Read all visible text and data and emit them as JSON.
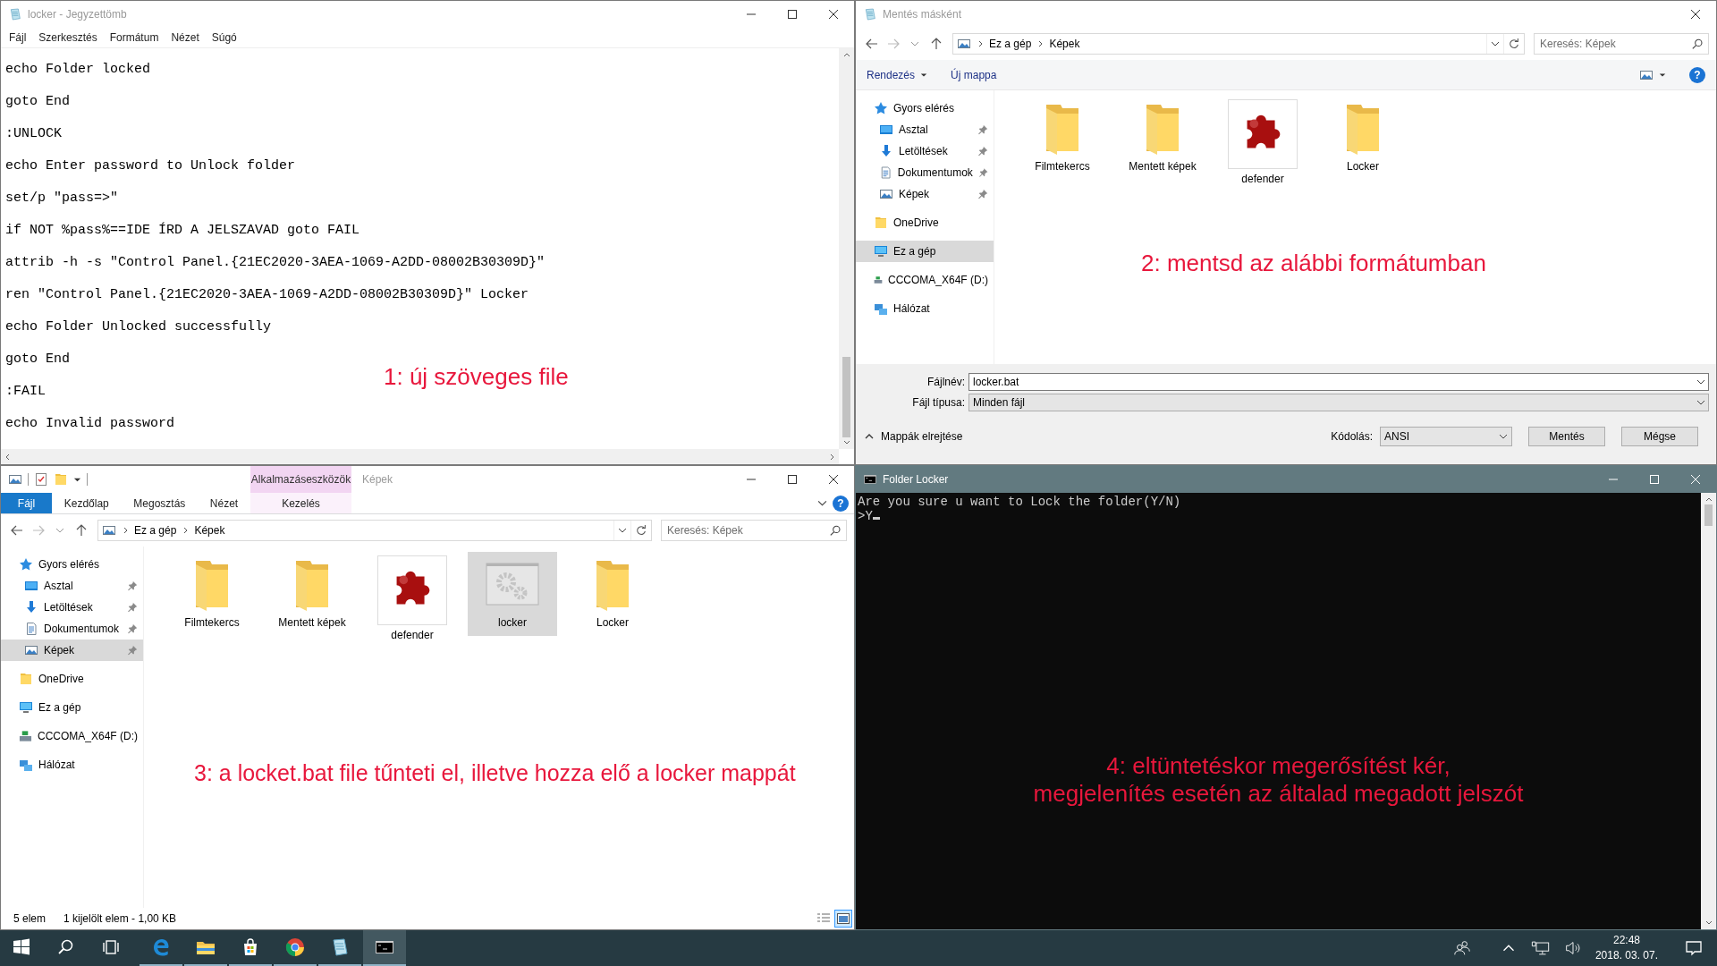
{
  "notepad": {
    "title": "locker - Jegyzettömb",
    "menu": [
      "Fájl",
      "Szerkesztés",
      "Formátum",
      "Nézet",
      "Súgó"
    ],
    "lines": [
      "echo Folder locked",
      "goto End",
      ":UNLOCK",
      "echo Enter password to Unlock folder",
      "set/p \"pass=>\"",
      "if NOT %pass%==IDE ÍRD A JELSZAVAD goto FAIL",
      "attrib -h -s \"Control Panel.{21EC2020-3AEA-1069-A2DD-08002B30309D}\"",
      "ren \"Control Panel.{21EC2020-3AEA-1069-A2DD-08002B30309D}\" Locker",
      "echo Folder Unlocked successfully",
      "goto End",
      ":FAIL",
      "echo Invalid password"
    ],
    "annotation": "1: új szöveges file"
  },
  "save_dialog": {
    "title": "Mentés másként",
    "path": [
      "Ez a gép",
      "Képek"
    ],
    "search": {
      "placeholder": "Keresés: Képek"
    },
    "toolbar": [
      {
        "label": "Rendezés",
        "kind": "menu"
      },
      {
        "label": "Új mappa",
        "kind": "plain"
      }
    ],
    "help": "?",
    "nav": [
      {
        "label": "Gyors elérés",
        "kind": "quick",
        "selected": false,
        "children": [
          {
            "label": "Asztal",
            "kind": "desktop",
            "selected": false
          },
          {
            "label": "Letöltések",
            "kind": "download",
            "selected": false
          },
          {
            "label": "Dokumentumok",
            "kind": "docs",
            "selected": false
          },
          {
            "label": "Képek",
            "kind": "pictures",
            "selected": false
          }
        ]
      },
      {
        "label": "OneDrive",
        "kind": "onedrive",
        "selected": false
      },
      {
        "label": "Ez a gép",
        "kind": "pc",
        "selected": true
      },
      {
        "label": "CCCOMA_X64F (D:)",
        "kind": "drive",
        "selected": false
      },
      {
        "label": "Hálózat",
        "kind": "network",
        "selected": false
      }
    ],
    "files": [
      {
        "name": "Filmtekercs",
        "kind": "folder",
        "selected": false
      },
      {
        "name": "Mentett képek",
        "kind": "folder",
        "selected": false
      },
      {
        "name": "defender",
        "kind": "app",
        "selected": false
      },
      {
        "name": "Locker",
        "kind": "folder",
        "selected": false
      }
    ],
    "annotation": "2: mentsd az alábbi formátumban",
    "fields": [
      {
        "label": "Fájlnév:",
        "value": "locker.bat",
        "kind": "combo"
      },
      {
        "label": "Fájl típusa:",
        "value": "Minden fájl",
        "kind": "select"
      }
    ],
    "hide_folders": "Mappák elrejtése",
    "encoding": {
      "label": "Kódolás:",
      "value": "ANSI"
    },
    "buttons": [
      "Mentés",
      "Mégse"
    ]
  },
  "explorer": {
    "title": "Képek",
    "context_group": "Alkalmazáseszközök",
    "tabs": [
      {
        "label": "Fájl",
        "kind": "file"
      },
      {
        "label": "Kezdőlap",
        "kind": "tab"
      },
      {
        "label": "Megosztás",
        "kind": "tab"
      },
      {
        "label": "Nézet",
        "kind": "tab"
      },
      {
        "label": "Kezelés",
        "kind": "context"
      }
    ],
    "help": "?",
    "path": [
      "Ez a gép",
      "Képek"
    ],
    "search": {
      "placeholder": "Keresés: Képek"
    },
    "nav": [
      {
        "label": "Gyors elérés",
        "kind": "quick",
        "selected": false,
        "children": [
          {
            "label": "Asztal",
            "kind": "desktop",
            "selected": false
          },
          {
            "label": "Letöltések",
            "kind": "download",
            "selected": false
          },
          {
            "label": "Dokumentumok",
            "kind": "docs",
            "selected": false
          },
          {
            "label": "Képek",
            "kind": "pictures",
            "selected": true
          }
        ]
      },
      {
        "label": "OneDrive",
        "kind": "onedrive",
        "selected": false
      },
      {
        "label": "Ez a gép",
        "kind": "pc",
        "selected": false
      },
      {
        "label": "CCCOMA_X64F (D:)",
        "kind": "drive",
        "selected": false
      },
      {
        "label": "Hálózat",
        "kind": "network",
        "selected": false
      }
    ],
    "files": [
      {
        "name": "Filmtekercs",
        "kind": "folder",
        "selected": false
      },
      {
        "name": "Mentett képek",
        "kind": "folder",
        "selected": false
      },
      {
        "name": "defender",
        "kind": "app",
        "selected": false
      },
      {
        "name": "locker",
        "kind": "batch",
        "selected": true
      },
      {
        "name": "Locker",
        "kind": "folder",
        "selected": false
      }
    ],
    "annotation": "3: a locket.bat file tűnteti el, illetve hozza elő a locker mappát",
    "status": [
      "5 elem",
      "1 kijelölt elem - 1,00 KB"
    ],
    "views": [
      {
        "kind": "details",
        "selected": false
      },
      {
        "kind": "large",
        "selected": true
      }
    ]
  },
  "console": {
    "title": "Folder Locker",
    "lines": [
      "Are you sure u want to Lock the folder(Y/N)",
      ">Y"
    ],
    "annotation": [
      "4: eltüntetéskor megerősítést kér,",
      "megjelenítés esetén az általad megadott jelszót"
    ]
  },
  "taskbar": {
    "apps": [
      {
        "kind": "start",
        "running": false,
        "active": false
      },
      {
        "kind": "search",
        "running": false,
        "active": false
      },
      {
        "kind": "taskview",
        "running": false,
        "active": false
      },
      {
        "kind": "edge",
        "running": true,
        "active": false
      },
      {
        "kind": "explorer",
        "running": true,
        "active": false
      },
      {
        "kind": "store",
        "running": true,
        "active": false
      },
      {
        "kind": "chrome",
        "running": true,
        "active": false
      },
      {
        "kind": "notepad",
        "running": true,
        "active": false
      },
      {
        "kind": "cmd",
        "running": true,
        "active": true
      }
    ],
    "clock": {
      "time": "22:48",
      "date": "2018. 03. 07."
    }
  }
}
